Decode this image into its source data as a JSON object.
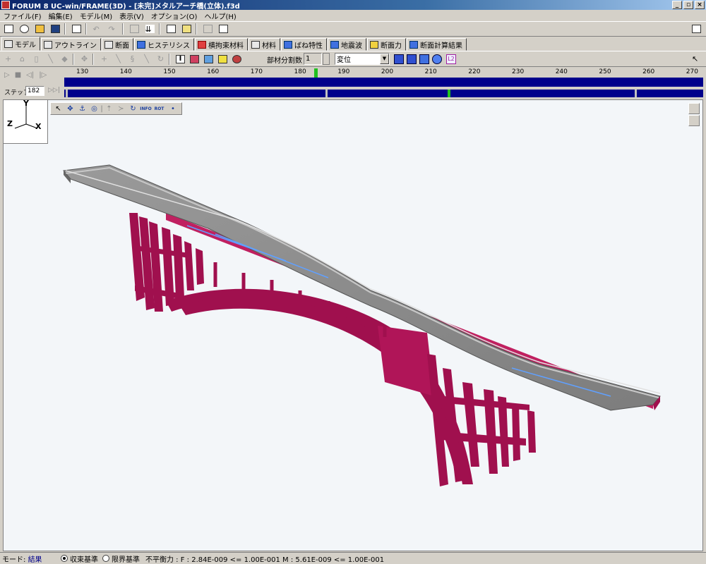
{
  "window": {
    "title": "FORUM 8  UC-win/FRAME(3D) - [未完]メタルアーチ橋(立体).f3d"
  },
  "menu": [
    "ファイル(F)",
    "編集(E)",
    "モデル(M)",
    "表示(V)",
    "オプション(O)",
    "ヘルプ(H)"
  ],
  "tabs": [
    {
      "label": "モデル",
      "icon": "model-icon"
    },
    {
      "label": "アウトライン",
      "icon": "outline-icon"
    },
    {
      "label": "断面",
      "icon": "section-icon"
    },
    {
      "label": "ヒステリシス",
      "icon": "hysteresis-icon"
    },
    {
      "label": "横拘束材料",
      "icon": "lateral-restraint-icon"
    },
    {
      "label": "材料",
      "icon": "material-icon"
    },
    {
      "label": "ばね特性",
      "icon": "spring-icon"
    },
    {
      "label": "地震波",
      "icon": "seismic-wave-icon"
    },
    {
      "label": "断面力",
      "icon": "section-force-icon"
    },
    {
      "label": "断面計算結果",
      "icon": "section-calc-icon"
    }
  ],
  "toolbar2": {
    "segment_label": "部材分割数",
    "segment_value": "1",
    "result_type": "変位"
  },
  "animation": {
    "ruler_ticks": [
      "130",
      "140",
      "150",
      "160",
      "170",
      "180",
      "190",
      "200",
      "210",
      "220",
      "230",
      "240",
      "250",
      "260",
      "270"
    ],
    "step_label": "ステップ:",
    "step_value": "182"
  },
  "axis": {
    "y": "Y",
    "z": "Z",
    "x": "X"
  },
  "view_tools": [
    "INFO",
    "ROT"
  ],
  "status": {
    "mode_label": "モード:",
    "mode_value": "結果",
    "radio_convergence": "収束基準",
    "radio_limit": "限界基準",
    "imbalance": "不平衡力 : F : 2.84E-009 <= 1.00E-001  M : 5.61E-009 <= 1.00E-001"
  },
  "colors": {
    "frame": "#a0104e",
    "deck": "#8e8e8e",
    "accent": "#00008b"
  }
}
